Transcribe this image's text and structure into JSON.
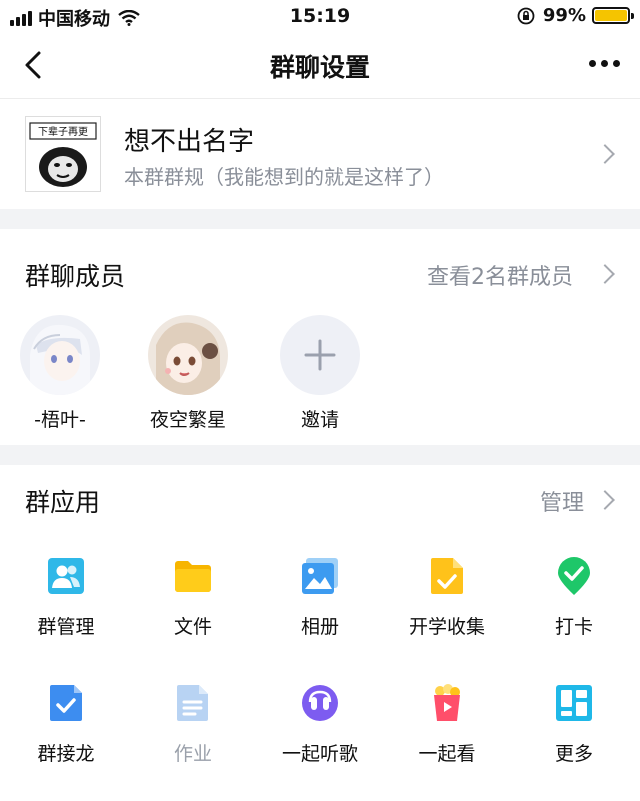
{
  "status_bar": {
    "carrier": "中国移动",
    "time": "15:19",
    "battery": "99%"
  },
  "nav": {
    "title": "群聊设置"
  },
  "group": {
    "name": "想不出名字",
    "rule": "本群群规（我能想到的就是这样了）",
    "avatar_text": "下辈子再更"
  },
  "members_section": {
    "title": "群聊成员",
    "link": "查看2名群成员",
    "members": [
      {
        "name": "-梧叶-"
      },
      {
        "name": "夜空繁星"
      }
    ],
    "invite_label": "邀请"
  },
  "apps_section": {
    "title": "群应用",
    "link": "管理",
    "apps": [
      {
        "label": "群管理",
        "icon": "group-manage-icon"
      },
      {
        "label": "文件",
        "icon": "folder-icon"
      },
      {
        "label": "相册",
        "icon": "album-icon"
      },
      {
        "label": "开学收集",
        "icon": "collect-icon"
      },
      {
        "label": "打卡",
        "icon": "checkin-icon"
      },
      {
        "label": "群接龙",
        "icon": "relay-icon"
      },
      {
        "label": "作业",
        "icon": "homework-icon"
      },
      {
        "label": "一起听歌",
        "icon": "music-icon"
      },
      {
        "label": "一起看",
        "icon": "watch-icon"
      },
      {
        "label": "更多",
        "icon": "more-apps-icon"
      }
    ]
  }
}
